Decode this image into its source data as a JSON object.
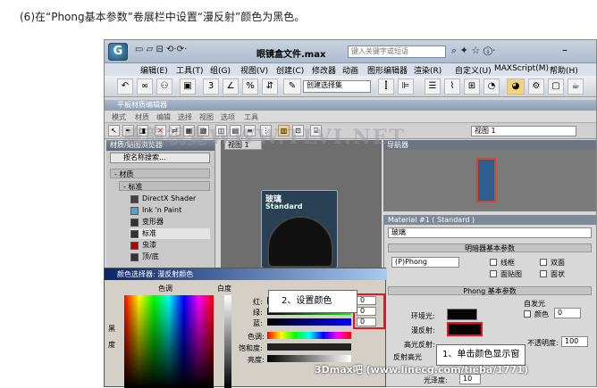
{
  "caption": "(6)在“Phong基本参数”卷展栏中设置“漫反射”颜色为黑色。",
  "app": {
    "logo": "G",
    "file_title": "眼镜盒文件.max",
    "search_placeholder": "键入关键字或短语",
    "menu": [
      "编辑(E)",
      "工具(T)",
      "组(G)",
      "视图(V)",
      "创建(C)",
      "修改器",
      "动画",
      "图形编辑器",
      "渲染(R)",
      "自定义(U)",
      "MAXScript(M)",
      "帮助(H)"
    ],
    "selection_set": "创建选择集"
  },
  "sme": {
    "title": "平板材质编辑器",
    "menu": [
      "模式",
      "材质",
      "编辑",
      "选择",
      "视图",
      "选项",
      "工具"
    ],
    "view_select": "视图 1"
  },
  "browser": {
    "title": "材质/贴图浏览器",
    "search": "按名称搜索...",
    "cat_materials": "- 材质",
    "cat_standard": "- 标准",
    "items": [
      "DirectX Shader",
      "Ink 'n Paint",
      "变形器",
      "标准",
      "虫漆",
      "顶/底"
    ]
  },
  "view": {
    "tab": "视图 1",
    "node_name": "玻璃",
    "node_type": "Standard"
  },
  "navigator": {
    "title": "导航器"
  },
  "watermark": "騰龍視覺WWW.TLVI.NET",
  "material": {
    "title": "Material #1  ( Standard )",
    "name": "玻璃",
    "shader_rollout": "明暗器基本参数",
    "shader": "(P)Phong",
    "wire": "线框",
    "two_sided": "双面",
    "face_map": "面贴图",
    "faceted": "面状",
    "phong_rollout": "Phong 基本参数",
    "self_illum": "自发光",
    "color_label": "颜色",
    "self_illum_value": "0",
    "ambient": "环境光:",
    "diffuse": "漫反射:",
    "specular": "高光反射:",
    "opacity_label": "不透明度:",
    "opacity": "100",
    "reflect_hl": "反射高光",
    "gloss_label": "光泽度:",
    "gloss": "10"
  },
  "dialog": {
    "title": "颜色选择器: 漫反射颜色",
    "hue": "色调",
    "white": "白度",
    "black": "黑",
    "degree": "度",
    "red": "红:",
    "green": "绿:",
    "blue": "蓝:",
    "hue2": "色调:",
    "sat": "饱和度:",
    "val": "亮度:",
    "r": "0",
    "g": "0",
    "b": "0"
  },
  "callouts": {
    "c1": "1、单击颜色显示窗",
    "c2": "2、设置颜色"
  },
  "footer": "3Dmax吧 (www.linecg.com/tieba/1771)"
}
